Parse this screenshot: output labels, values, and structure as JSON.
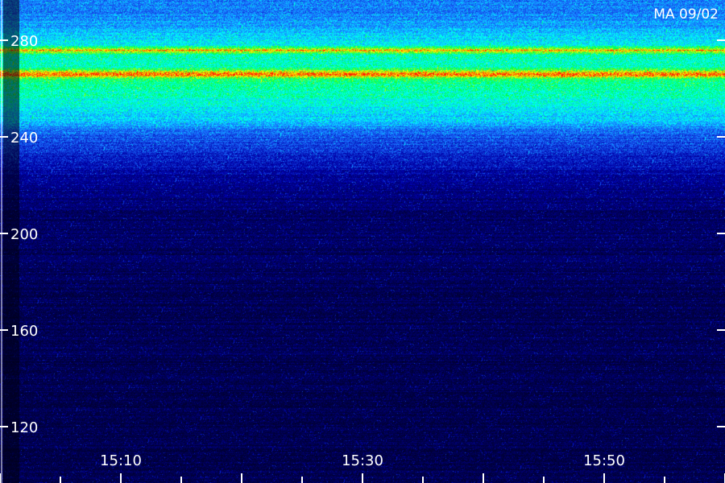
{
  "chart_data": {
    "type": "heatmap",
    "title": "MA 09/02",
    "xlabel": "",
    "ylabel": "",
    "y_ticks": [
      {
        "value": 280,
        "label": "280"
      },
      {
        "value": 240,
        "label": "240"
      },
      {
        "value": 200,
        "label": "200"
      },
      {
        "value": 160,
        "label": "160"
      },
      {
        "value": 120,
        "label": "120"
      }
    ],
    "x_ticks": [
      {
        "label": "15:10",
        "minutes": 10
      },
      {
        "label": "15:30",
        "minutes": 30
      },
      {
        "label": "15:50",
        "minutes": 50
      }
    ],
    "x_range_minutes": [
      0,
      60
    ],
    "y_range": [
      105,
      295
    ],
    "intensity_profile": [
      {
        "y": 292,
        "level": 0.34
      },
      {
        "y": 285,
        "level": 0.4
      },
      {
        "y": 278,
        "level": 0.5
      },
      {
        "y": 276,
        "level": 0.9
      },
      {
        "y": 274,
        "level": 0.55
      },
      {
        "y": 269,
        "level": 0.55
      },
      {
        "y": 266,
        "level": 0.97
      },
      {
        "y": 264,
        "level": 0.62
      },
      {
        "y": 255,
        "level": 0.52
      },
      {
        "y": 246,
        "level": 0.42
      },
      {
        "y": 241,
        "level": 0.3
      },
      {
        "y": 232,
        "level": 0.22
      },
      {
        "y": 222,
        "level": 0.12
      },
      {
        "y": 208,
        "level": 0.07
      },
      {
        "y": 180,
        "level": 0.05
      },
      {
        "y": 150,
        "level": 0.04
      },
      {
        "y": 105,
        "level": 0.03
      }
    ],
    "colormap": [
      "#000033",
      "#0000aa",
      "#1a6cff",
      "#00ffff",
      "#00ff44",
      "#ffff00",
      "#ff2000"
    ]
  }
}
